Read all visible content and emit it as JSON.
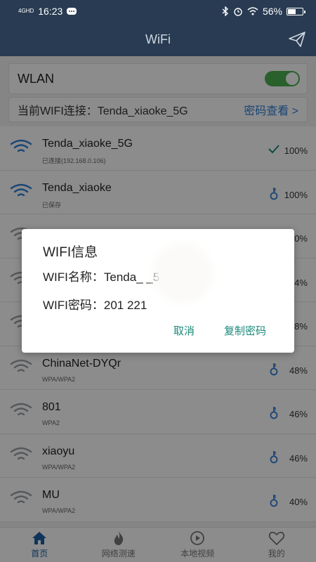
{
  "status": {
    "network": "4GHD",
    "time": "16:23",
    "battery": "56%",
    "battery_level": 0.56
  },
  "appbar": {
    "title": "WiFi"
  },
  "wlan": {
    "label": "WLAN",
    "enabled": true
  },
  "current": {
    "text": "当前WIFI连接：Tenda_xiaoke_5G",
    "link": "密码查看 >"
  },
  "networks": [
    {
      "ssid": "Tenda_xiaoke_5G",
      "sub": "已连接(192.168.0.106)",
      "signal": "100%",
      "state_icon": "check-icon",
      "active": true
    },
    {
      "ssid": "Tenda_xiaoke",
      "sub": "已保存",
      "signal": "100%",
      "state_icon": "key-icon",
      "active": true
    },
    {
      "ssid": "",
      "sub": "",
      "signal": "0%",
      "state_icon": "key-icon",
      "active": false
    },
    {
      "ssid": "",
      "sub": "",
      "signal": "4%",
      "state_icon": "key-icon",
      "active": false
    },
    {
      "ssid": "",
      "sub": "",
      "signal": "8%",
      "state_icon": "key-icon",
      "active": false
    },
    {
      "ssid": "ChinaNet-DYQr",
      "sub": "WPA/WPA2",
      "signal": "48%",
      "state_icon": "key-icon",
      "active": false
    },
    {
      "ssid": "801",
      "sub": "WPA2",
      "signal": "46%",
      "state_icon": "key-icon",
      "active": false
    },
    {
      "ssid": "xiaoyu",
      "sub": "WPA/WPA2",
      "signal": "46%",
      "state_icon": "key-icon",
      "active": false
    },
    {
      "ssid": "MU",
      "sub": "WPA/WPA2",
      "signal": "40%",
      "state_icon": "key-icon",
      "active": false
    }
  ],
  "dialog": {
    "title": "WIFI信息",
    "name_line": "WIFI名称：Tenda_        _5G",
    "password_line": "WIFI密码：201      221",
    "cancel": "取消",
    "copy": "复制密码"
  },
  "tabs": [
    {
      "label": "首页",
      "icon": "home-icon",
      "active": true
    },
    {
      "label": "网络测速",
      "icon": "flame-icon",
      "active": false
    },
    {
      "label": "本地视频",
      "icon": "play-icon",
      "active": false
    },
    {
      "label": "我的",
      "icon": "heart-icon",
      "active": false
    }
  ],
  "colors": {
    "header": "#283b52",
    "accent": "#2f7fd8",
    "toggle": "#4caf50",
    "dialog_button": "#1a8a7a"
  }
}
